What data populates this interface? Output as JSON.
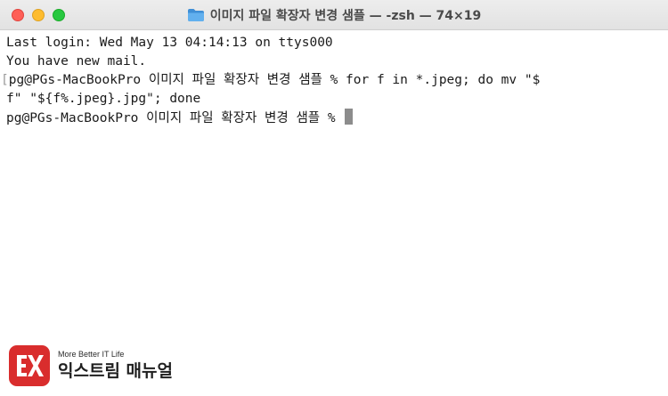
{
  "window": {
    "title": "이미지 파일 확장자 변경 샘플 — -zsh — 74×19"
  },
  "terminal": {
    "lines": [
      "Last login: Wed May 13 04:14:13 on ttys000",
      "You have new mail.",
      "pg@PGs-MacBookPro 이미지 파일 확장자 변경 샘플 % for f in *.jpeg; do mv \"$",
      "f\" \"${f%.jpeg}.jpg\"; done",
      "pg@PGs-MacBookPro 이미지 파일 확장자 변경 샘플 % "
    ],
    "mark_glyph": "["
  },
  "watermark": {
    "tagline": "More Better IT Life",
    "brand_name": "익스트림 매뉴얼"
  },
  "colors": {
    "close": "#fe5f57",
    "minimize": "#febc2e",
    "zoom": "#28c840",
    "folder": "#5aa7e8",
    "logo": "#d92d2d"
  },
  "icons": {
    "folder": "folder-icon",
    "logo": "ex-logo-icon"
  }
}
